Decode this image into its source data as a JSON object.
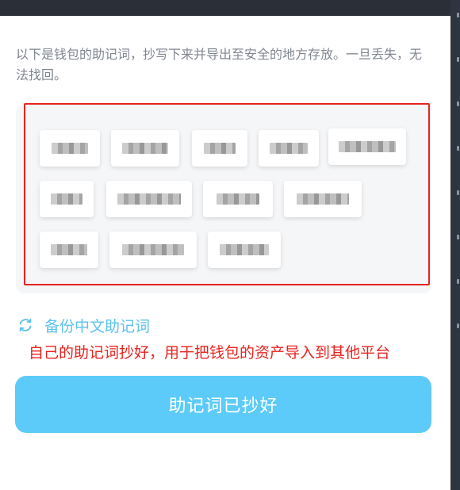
{
  "intro_text": "以下是钱包的助记词，抄写下来并导出至安全的地方存放。一旦丢失，无法找回。",
  "mnemonic_words": [
    "",
    "",
    "",
    "",
    "",
    "",
    "",
    "",
    "",
    "",
    "",
    ""
  ],
  "mnemonic_note": "words are pixelated/redacted in the screenshot",
  "backup_chinese_label": "备份中文助记词",
  "annotation_text": "自己的助记词抄好，用于把钱包的资产导入到其他平台",
  "confirm_button_label": "助记词已抄好",
  "icons": {
    "backup": "refresh-icon"
  },
  "colors": {
    "accent": "#5cc2ec",
    "button": "#5ccbf9",
    "annotation": "#e8231f",
    "frame": "#e8231f"
  }
}
